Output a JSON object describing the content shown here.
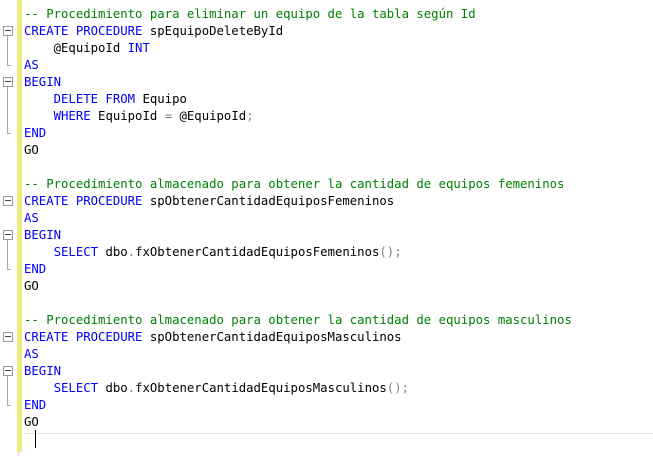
{
  "editor": {
    "lines": [
      {
        "parts": [
          {
            "t": "-- Procedimiento para eliminar un equipo de la tabla según Id",
            "c": "cm"
          }
        ]
      },
      {
        "parts": [
          {
            "t": "CREATE PROCEDURE",
            "c": "kw"
          },
          {
            "t": " spEquipoDeleteById",
            "c": ""
          }
        ]
      },
      {
        "parts": [
          {
            "t": "    @EquipoId ",
            "c": ""
          },
          {
            "t": "INT",
            "c": "kw"
          }
        ]
      },
      {
        "parts": [
          {
            "t": "AS",
            "c": "kw"
          }
        ]
      },
      {
        "parts": [
          {
            "t": "BEGIN",
            "c": "kw"
          }
        ]
      },
      {
        "parts": [
          {
            "t": "    DELETE FROM",
            "c": "kw"
          },
          {
            "t": " Equipo",
            "c": ""
          }
        ]
      },
      {
        "parts": [
          {
            "t": "    WHERE",
            "c": "kw"
          },
          {
            "t": " EquipoId ",
            "c": ""
          },
          {
            "t": "=",
            "c": "gl"
          },
          {
            "t": " @EquipoId",
            "c": ""
          },
          {
            "t": ";",
            "c": "gl"
          }
        ]
      },
      {
        "parts": [
          {
            "t": "END",
            "c": "kw"
          }
        ]
      },
      {
        "parts": [
          {
            "t": "GO",
            "c": ""
          }
        ]
      },
      {
        "parts": []
      },
      {
        "parts": [
          {
            "t": "-- Procedimiento almacenado para obtener la cantidad de equipos femeninos",
            "c": "cm"
          }
        ]
      },
      {
        "parts": [
          {
            "t": "CREATE PROCEDURE",
            "c": "kw"
          },
          {
            "t": " spObtenerCantidadEquiposFemeninos",
            "c": ""
          }
        ]
      },
      {
        "parts": [
          {
            "t": "AS",
            "c": "kw"
          }
        ]
      },
      {
        "parts": [
          {
            "t": "BEGIN",
            "c": "kw"
          }
        ]
      },
      {
        "parts": [
          {
            "t": "    SELECT",
            "c": "kw"
          },
          {
            "t": " dbo",
            "c": ""
          },
          {
            "t": ".",
            "c": "gl"
          },
          {
            "t": "fxObtenerCantidadEquiposFemeninos",
            "c": ""
          },
          {
            "t": "();",
            "c": "gl"
          }
        ]
      },
      {
        "parts": [
          {
            "t": "END",
            "c": "kw"
          }
        ]
      },
      {
        "parts": [
          {
            "t": "GO",
            "c": ""
          }
        ]
      },
      {
        "parts": []
      },
      {
        "parts": [
          {
            "t": "-- Procedimiento almacenado para obtener la cantidad de equipos masculinos",
            "c": "cm"
          }
        ]
      },
      {
        "parts": [
          {
            "t": "CREATE PROCEDURE",
            "c": "kw"
          },
          {
            "t": " spObtenerCantidadEquiposMasculinos",
            "c": ""
          }
        ]
      },
      {
        "parts": [
          {
            "t": "AS",
            "c": "kw"
          }
        ]
      },
      {
        "parts": [
          {
            "t": "BEGIN",
            "c": "kw"
          }
        ]
      },
      {
        "parts": [
          {
            "t": "    SELECT",
            "c": "kw"
          },
          {
            "t": " dbo",
            "c": ""
          },
          {
            "t": ".",
            "c": "gl"
          },
          {
            "t": "fxObtenerCantidadEquiposMasculinos",
            "c": ""
          },
          {
            "t": "();",
            "c": "gl"
          }
        ]
      },
      {
        "parts": [
          {
            "t": "END",
            "c": "kw"
          }
        ]
      },
      {
        "parts": [
          {
            "t": "GO",
            "c": ""
          }
        ]
      },
      {
        "parts": []
      }
    ],
    "folds": [
      1,
      4,
      11,
      13,
      19,
      21
    ]
  }
}
